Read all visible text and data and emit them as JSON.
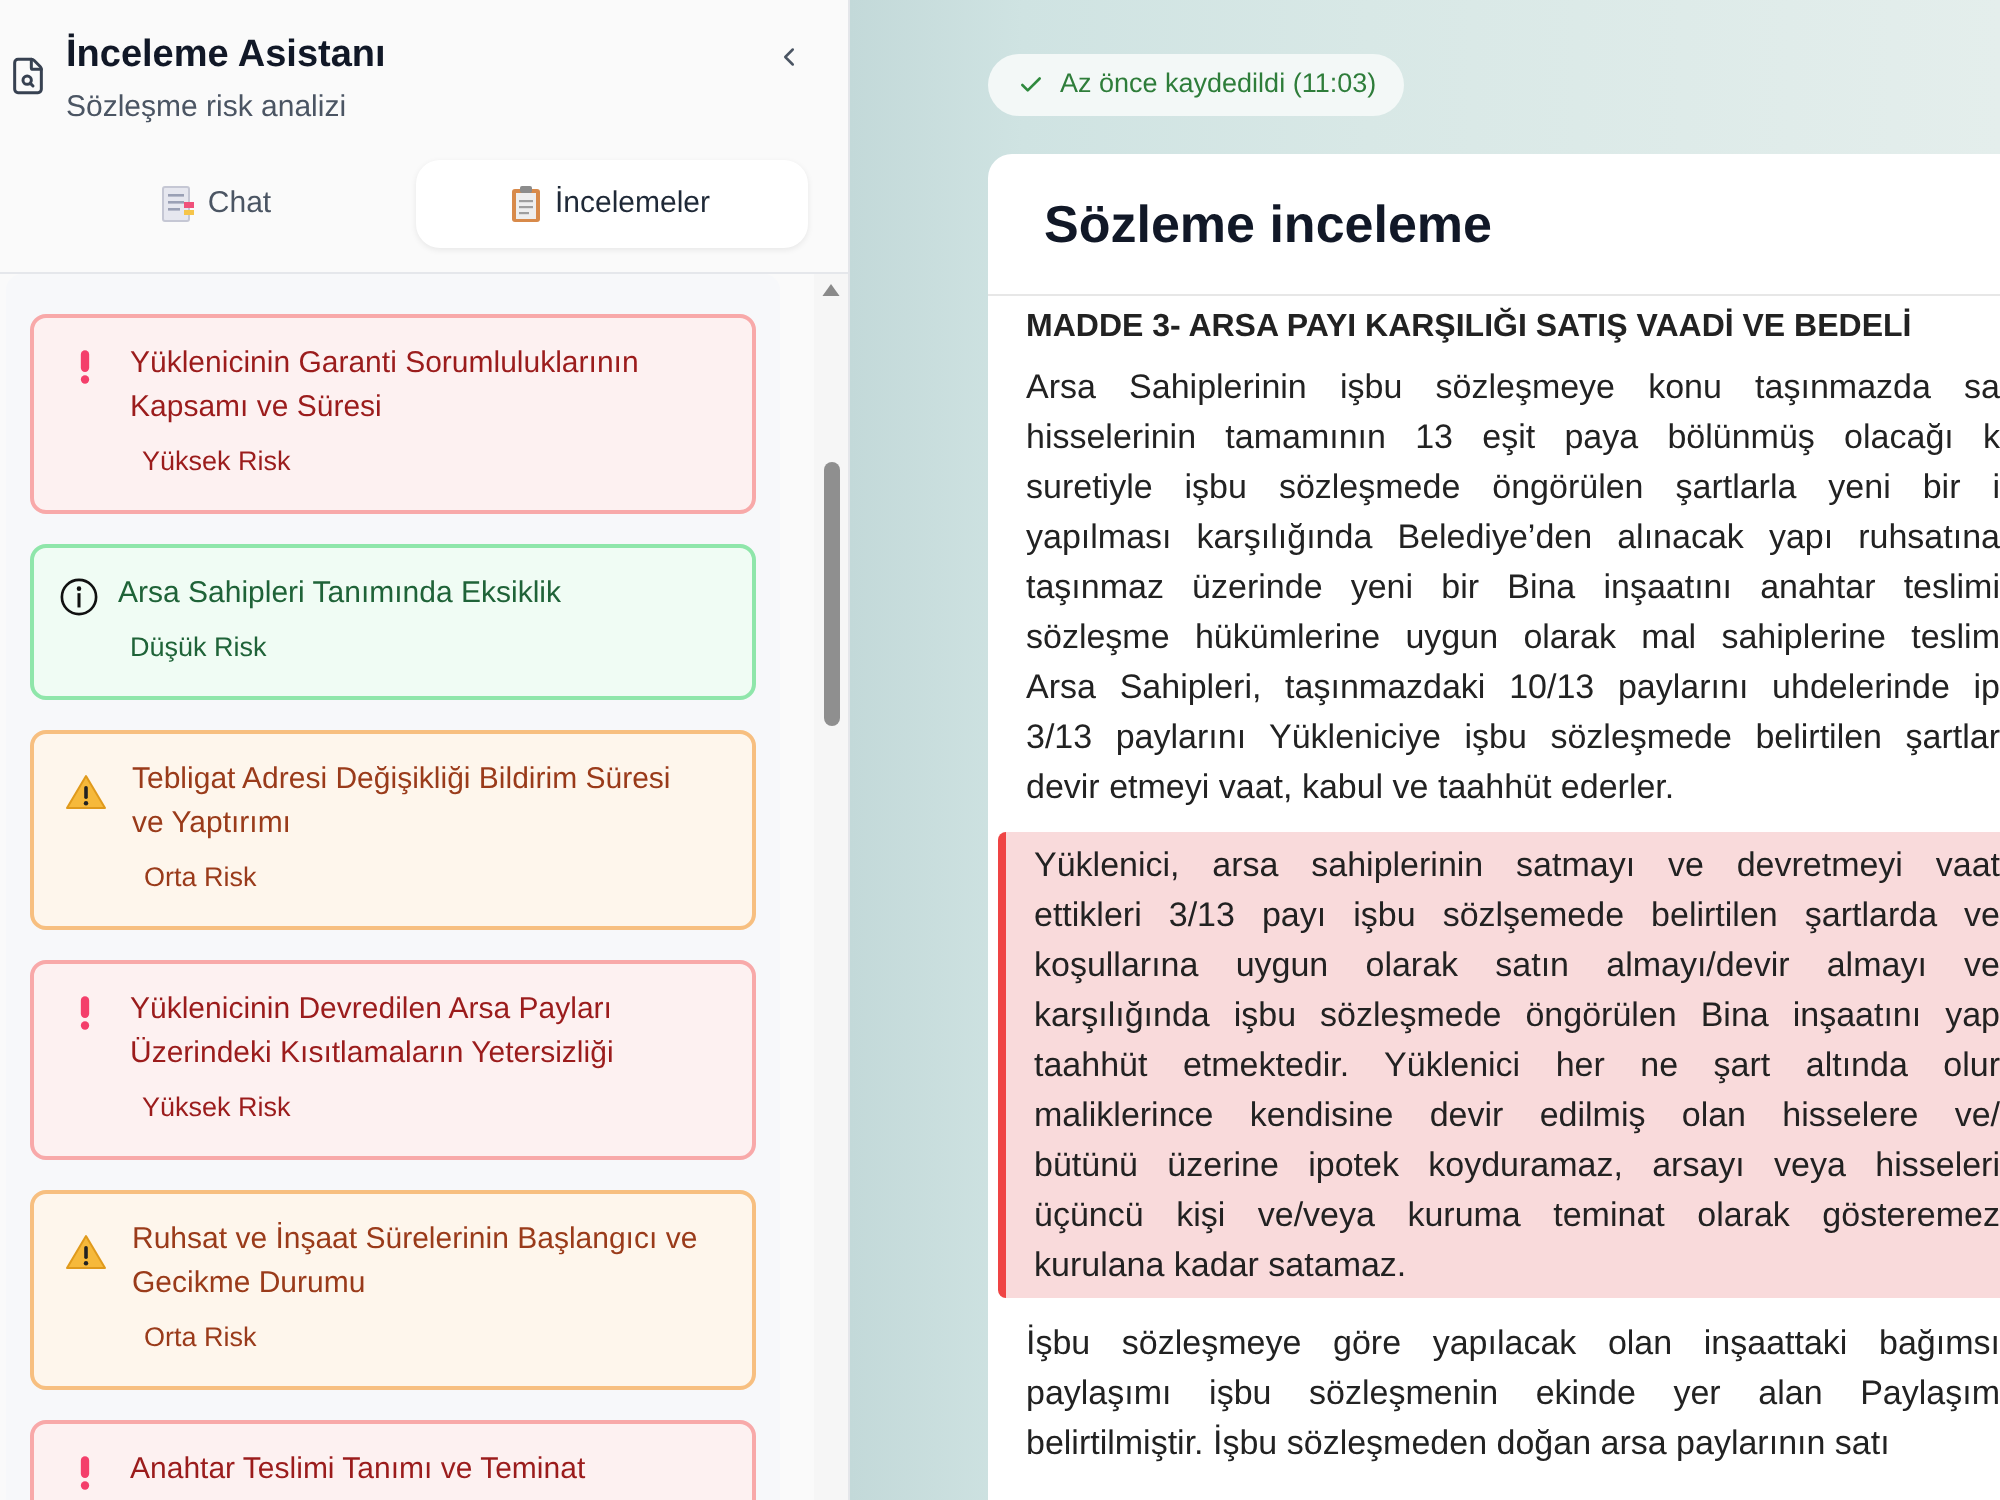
{
  "sidebar": {
    "title": "İnceleme Asistanı",
    "subtitle": "Sözleşme risk analizi",
    "tabs": [
      {
        "label": "Chat",
        "kind": "chat",
        "selected": false
      },
      {
        "label": "İncelemeler",
        "kind": "reviews",
        "selected": true
      }
    ],
    "findings": [
      {
        "kind": "high",
        "title": "Yüklenicinin Garanti Sorumluluklarının Kapsamı ve Süresi",
        "risk": "Yüksek Risk"
      },
      {
        "kind": "low",
        "title": "Arsa Sahipleri Tanımında Eksiklik",
        "risk": "Düşük Risk"
      },
      {
        "kind": "medium",
        "title": "Tebligat Adresi Değişikliği Bildirim Süresi ve Yaptırımı",
        "risk": "Orta Risk"
      },
      {
        "kind": "high",
        "title": "Yüklenicinin Devredilen Arsa Payları Üzerindeki Kısıtlamaların Yetersizliği",
        "risk": "Yüksek Risk"
      },
      {
        "kind": "medium",
        "title": "Ruhsat ve İnşaat Sürelerinin Başlangıcı ve Gecikme Durumu",
        "risk": "Orta Risk"
      },
      {
        "kind": "high",
        "title": "Anahtar Teslimi Tanımı ve Teminat"
      }
    ]
  },
  "save_status": "Az önce kaydedildi (11:03)",
  "document": {
    "title": "Sözleme inceleme",
    "section_heading": "MADDE 3- ARSA PAYI KARŞILIĞI SATIŞ VAADİ VE BEDELİ",
    "paragraphs": [
      {
        "highlighted": false,
        "lines": [
          "Arsa Sahiplerinin işbu sözleşmeye konu taşınmazda sa",
          "hisselerinin tamamının 13 eşit paya bölünmüş olacağı k",
          "suretiyle işbu sözleşmede öngörülen şartlarla yeni bir i",
          "yapılması karşılığında Belediye’den alınacak yapı ruhsatına",
          "taşınmaz üzerinde yeni bir Bina inşaatını anahtar teslimi",
          "sözleşme hükümlerine uygun olarak mal sahiplerine teslim",
          "Arsa Sahipleri, taşınmazdaki 10/13 paylarını uhdelerinde ip",
          "3/13 paylarını Yükleniciye işbu sözleşmede belirtilen şartlar",
          "devir etmeyi vaat, kabul ve taahhüt ederler."
        ]
      },
      {
        "highlighted": true,
        "lines": [
          "Yüklenici, arsa sahiplerinin satmayı ve devretmeyi vaat",
          "ettikleri 3/13 payı işbu sözlşemede belirtilen şartlarda ve",
          "koşullarına uygun olarak satın almayı/devir almayı ve",
          "karşılığında işbu sözleşmede öngörülen Bina inşaatını yap",
          "taahhüt etmektedir. Yüklenici her ne şart altında olur",
          "maliklerince kendisine devir edilmiş olan hisselere ve/",
          "bütünü üzerine ipotek koyduramaz, arsayı veya hisseleri",
          "üçüncü kişi ve/veya kuruma teminat olarak gösteremez",
          "kurulana kadar satamaz."
        ]
      },
      {
        "highlighted": false,
        "lines": [
          "İşbu sözleşmeye göre yapılacak olan inşaattaki bağımsı",
          "paylaşımı işbu sözleşmenin ekinde yer alan Paylaşım",
          "belirtilmiştir. İşbu sözleşmeden doğan arsa paylarının satı"
        ]
      }
    ]
  }
}
